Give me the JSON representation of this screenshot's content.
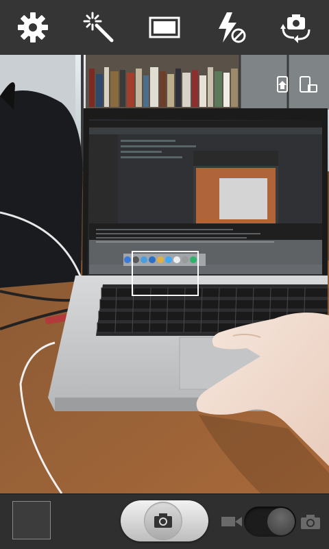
{
  "toolbar": {
    "icons": [
      "gear-icon",
      "magic-wand-icon",
      "aspect-ratio-icon",
      "flash-off-icon",
      "switch-camera-icon"
    ],
    "icon_color": "#ffffff",
    "background": "#353535"
  },
  "viewfinder": {
    "icons": [
      "phone-rotate-icon",
      "device-switch-icon"
    ],
    "focus_box_color": "#ffffff"
  },
  "bottom_bar": {
    "icons": [
      "camera-icon",
      "video-camera-icon"
    ],
    "mode": "photo"
  }
}
